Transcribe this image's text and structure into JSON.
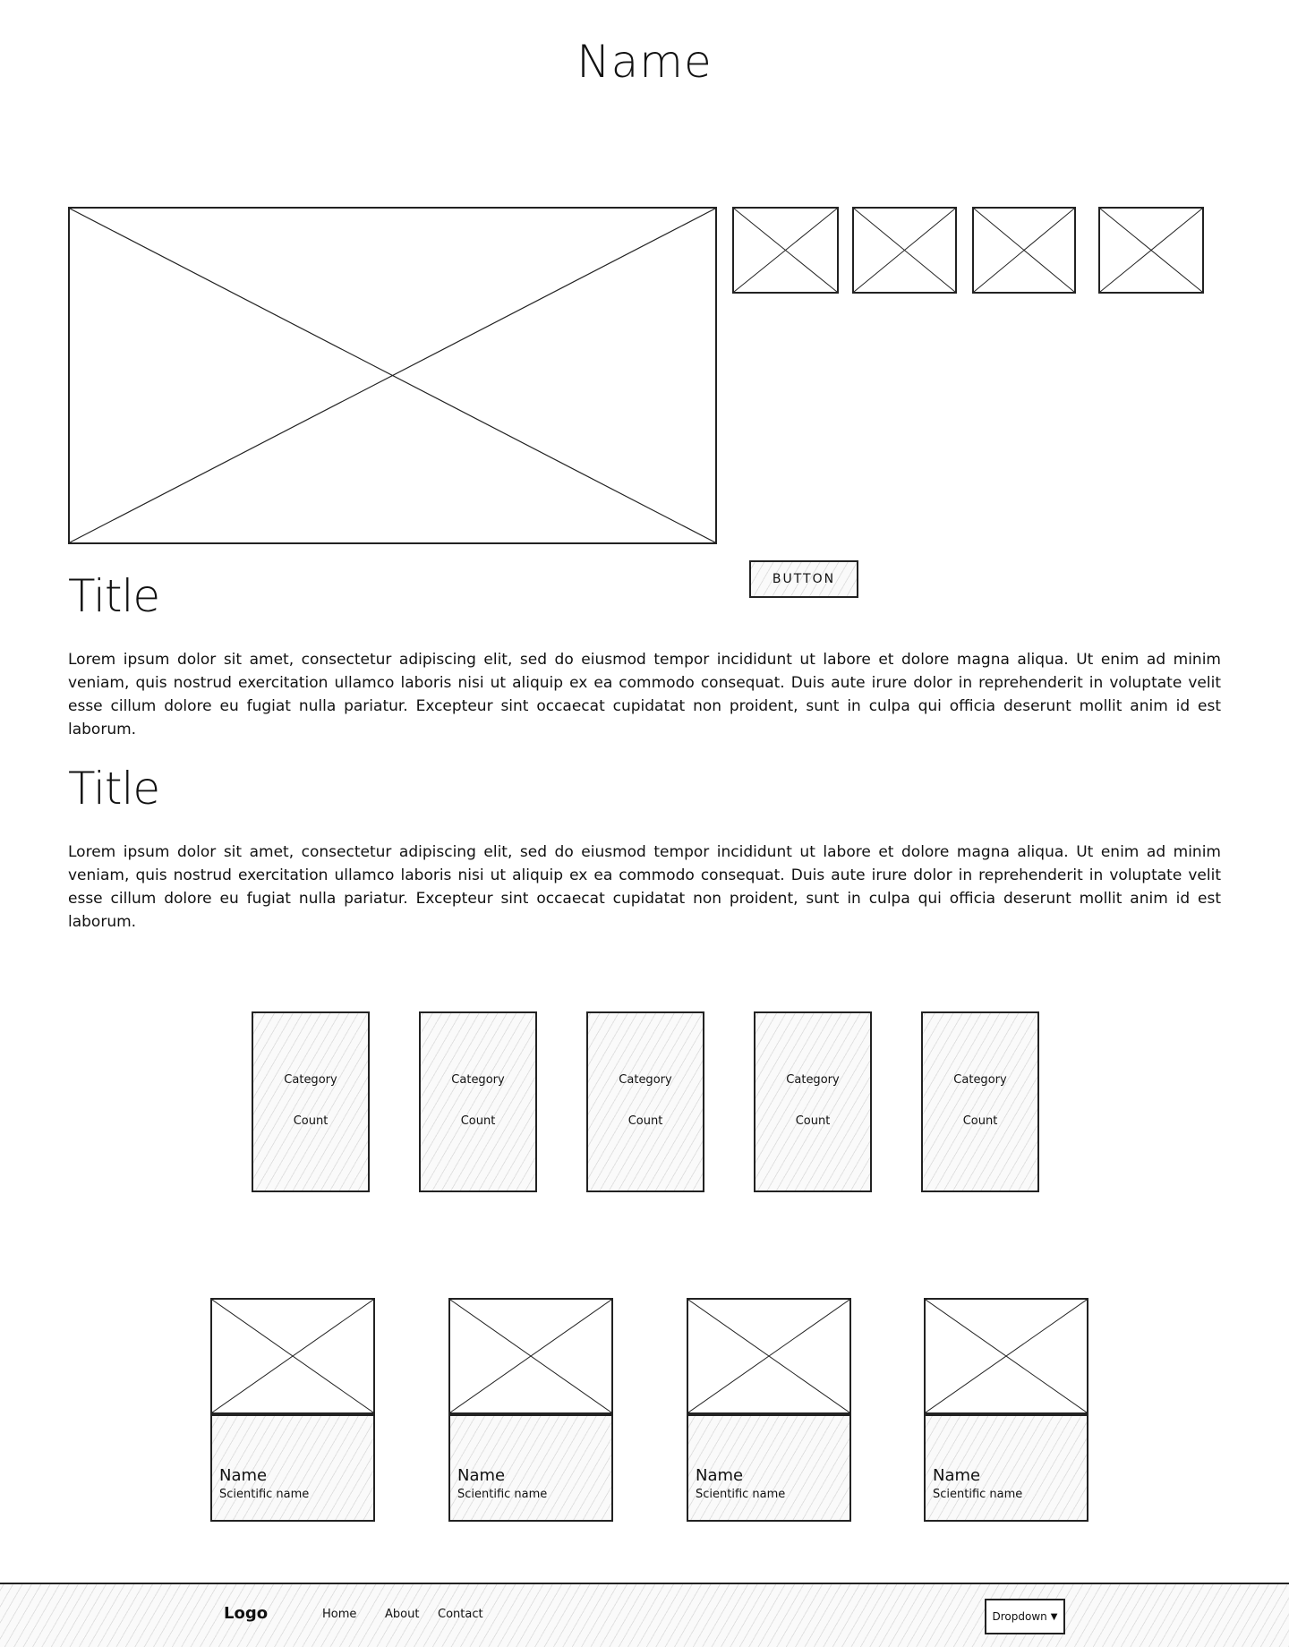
{
  "header": {
    "title": "Name"
  },
  "gallery": {
    "thumbnail_count": 4
  },
  "hero_button": {
    "label": "BUTTON"
  },
  "sections": [
    {
      "title": "Title",
      "body": "Lorem ipsum dolor sit amet, consectetur adipiscing elit, sed do eiusmod tempor incididunt ut labore et dolore magna aliqua. Ut enim ad minim veniam, quis nostrud exercitation ullamco laboris nisi ut aliquip ex ea commodo consequat. Duis aute irure dolor in reprehenderit in voluptate velit esse cillum dolore eu fugiat nulla pariatur. Excepteur sint occaecat cupidatat non proident, sunt in culpa qui officia deserunt mollit anim id est laborum."
    },
    {
      "title": "Title",
      "body": "Lorem ipsum dolor sit amet, consectetur adipiscing elit, sed do eiusmod tempor incididunt ut labore et dolore magna aliqua. Ut enim ad minim veniam, quis nostrud exercitation ullamco laboris nisi ut aliquip ex ea commodo consequat. Duis aute irure dolor in reprehenderit in voluptate velit esse cillum dolore eu fugiat nulla pariatur. Excepteur sint occaecat cupidatat non proident, sunt in culpa qui officia deserunt mollit anim id est laborum."
    }
  ],
  "categories": [
    {
      "category": "Category",
      "count": "Count"
    },
    {
      "category": "Category",
      "count": "Count"
    },
    {
      "category": "Category",
      "count": "Count"
    },
    {
      "category": "Category",
      "count": "Count"
    },
    {
      "category": "Category",
      "count": "Count"
    }
  ],
  "species": [
    {
      "name": "Name",
      "scientific": "Scientific name"
    },
    {
      "name": "Name",
      "scientific": "Scientific name"
    },
    {
      "name": "Name",
      "scientific": "Scientific name"
    },
    {
      "name": "Name",
      "scientific": "Scientific name"
    }
  ],
  "footer": {
    "logo": "Logo",
    "nav": [
      "Home",
      "About",
      "Contact"
    ],
    "dropdown": {
      "label": "Dropdown",
      "icon": "chevron-down-icon"
    }
  }
}
